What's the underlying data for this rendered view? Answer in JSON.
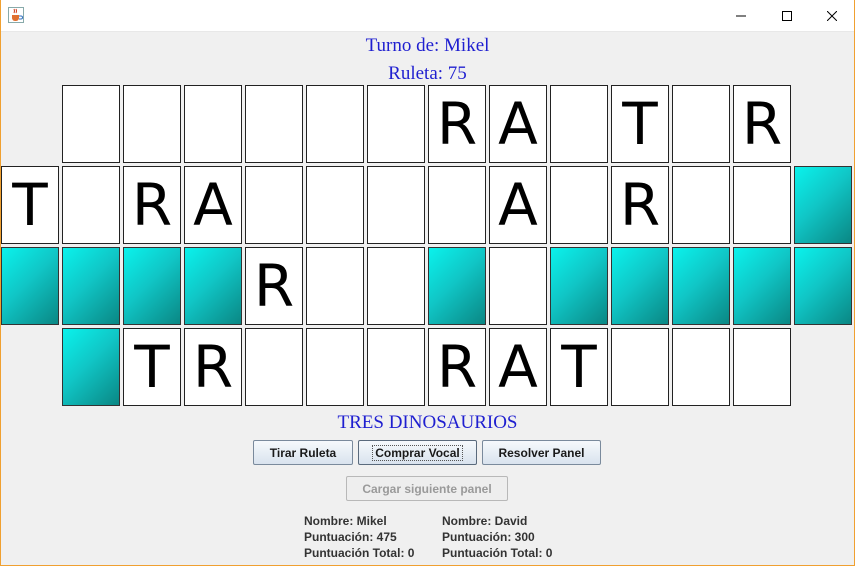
{
  "window": {
    "icon": "java-cup-icon",
    "controls": [
      "minimize-icon",
      "maximize-icon",
      "close-icon"
    ]
  },
  "header": {
    "turn": "Turno de: Mikel",
    "wheel": "Ruleta: 75"
  },
  "board": {
    "rows": [
      [
        null,
        "",
        "",
        "",
        "",
        "",
        "",
        "R",
        "A",
        "",
        "T",
        "",
        "R",
        null
      ],
      [
        "T",
        "",
        "R",
        "A",
        "",
        "",
        "",
        "",
        "A",
        "",
        "R",
        "",
        "",
        "#"
      ],
      [
        "#",
        "#",
        "#",
        "#",
        "R",
        "",
        "",
        "#",
        "",
        "#",
        "#",
        "#",
        "#",
        "#"
      ],
      [
        null,
        "#",
        "T",
        "R",
        "",
        "",
        "",
        "R",
        "A",
        "T",
        "",
        "",
        "",
        null
      ]
    ]
  },
  "clue": "TRES DINOSAURIOS",
  "buttons": {
    "spin": "Tirar Ruleta",
    "buy_vowel": "Comprar Vocal",
    "solve": "Resolver Panel",
    "next_panel": "Cargar siguiente panel"
  },
  "players": [
    {
      "name": "Nombre: Mikel",
      "score": "Puntuación: 475",
      "total": "Puntuación Total: 0"
    },
    {
      "name": "Nombre: David",
      "score": "Puntuación: 300",
      "total": "Puntuación Total: 0"
    }
  ],
  "colors": {
    "blank_tile": "#10c6c6",
    "heading_text": "#1f1fd0",
    "frame": "#f0a030"
  }
}
